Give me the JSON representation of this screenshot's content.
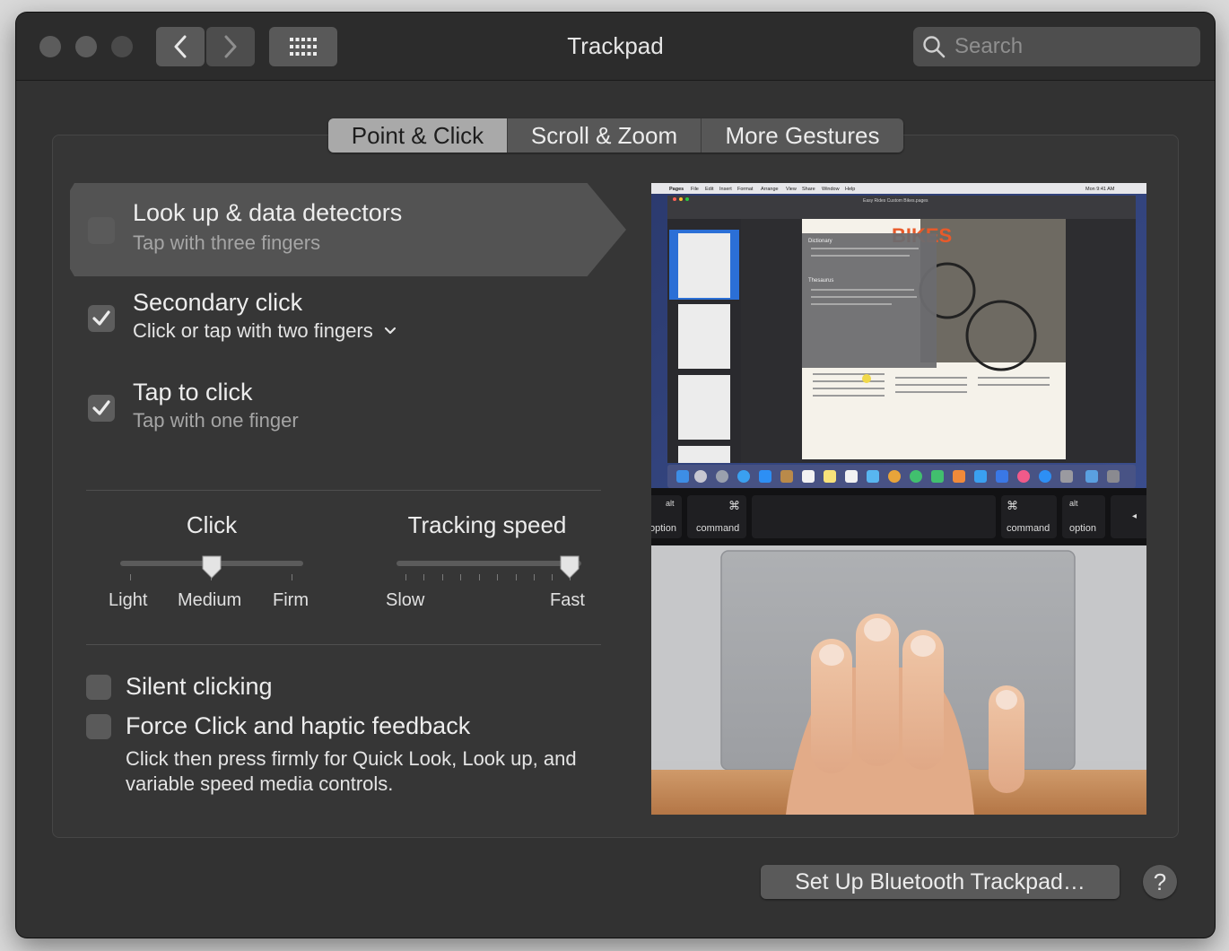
{
  "window": {
    "title": "Trackpad",
    "search_placeholder": "Search"
  },
  "tabs": [
    {
      "label": "Point & Click",
      "selected": true
    },
    {
      "label": "Scroll & Zoom",
      "selected": false
    },
    {
      "label": "More Gestures",
      "selected": false
    }
  ],
  "options": [
    {
      "title": "Look up & data detectors",
      "subtitle": "Tap with three fingers",
      "checked": false,
      "selected": true
    },
    {
      "title": "Secondary click",
      "subtitle": "Click or tap with two fingers",
      "checked": true,
      "selected": false
    },
    {
      "title": "Tap to click",
      "subtitle": "Tap with one finger",
      "checked": true,
      "selected": false
    }
  ],
  "click_slider": {
    "title": "Click",
    "labels": [
      "Light",
      "Medium",
      "Firm"
    ],
    "selected_label": "Medium",
    "position_fraction": 0.5
  },
  "tracking_slider": {
    "title": "Tracking speed",
    "min_label": "Slow",
    "max_label": "Fast",
    "position_fraction": 1.0
  },
  "silent_clicking": {
    "label": "Silent clicking",
    "checked": false
  },
  "force_click": {
    "label": "Force Click and haptic feedback",
    "checked": false,
    "description": "Click then press firmly for Quick Look, Look up, and variable speed media controls."
  },
  "preview": {
    "screen": {
      "menubar": [
        "Pages",
        "File",
        "Edit",
        "Insert",
        "Format",
        "Arrange",
        "View",
        "Share",
        "Window",
        "Help"
      ],
      "clock": "Mon 9:41 AM",
      "document_title": "Easy Rides Custom Bikes.pages",
      "heading_fragment": "BIKES",
      "popover_title": "Dictionary",
      "popover_section": "Thesaurus"
    },
    "keyboard": [
      "option",
      "command",
      "command",
      "option"
    ],
    "keyboard_alt": "alt"
  },
  "buttons": {
    "setup_bluetooth": "Set Up Bluetooth Trackpad…",
    "help": "?"
  },
  "colors": {
    "window_bg": "#323232",
    "titlebar_bg": "#2c2c2c",
    "selected_tab": "#a9a9a9",
    "selected_row": "#535353"
  }
}
